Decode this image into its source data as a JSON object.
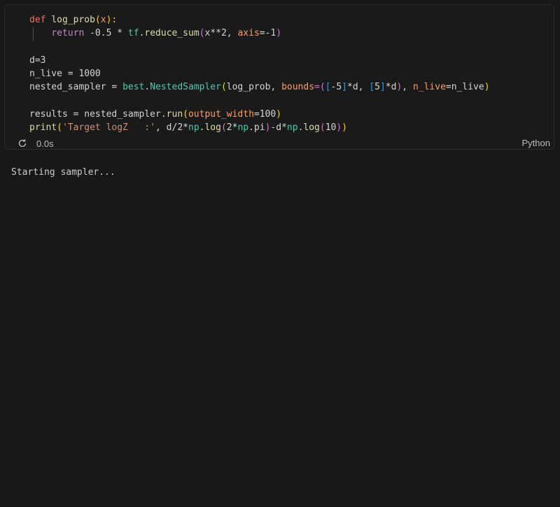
{
  "cell": {
    "language_label": "Python",
    "exec_time": "0.0s",
    "icon": "rerun-icon",
    "code_lines": [
      [
        [
          "def",
          "#f47067"
        ],
        [
          " ",
          "#d4d4d4"
        ],
        [
          "log_prob",
          "#dcdcaa"
        ],
        [
          "(",
          "#ffd700"
        ],
        [
          "x",
          "#ff9e64"
        ],
        [
          "):",
          "#ffd700"
        ]
      ],
      [
        [
          "    ",
          "#d4d4d4"
        ],
        [
          "return",
          "#c586c0"
        ],
        [
          " -0.5 * ",
          "#d4d4d4"
        ],
        [
          "tf",
          "#4ec9b0"
        ],
        [
          ".",
          "#d4d4d4"
        ],
        [
          "reduce_sum",
          "#dcdcaa"
        ],
        [
          "(",
          "#da70d6"
        ],
        [
          "x**2, ",
          "#d4d4d4"
        ],
        [
          "axis",
          "#ff9e64"
        ],
        [
          "=-1",
          "#d4d4d4"
        ],
        [
          ")",
          "#da70d6"
        ]
      ],
      [
        [
          "",
          "#d4d4d4"
        ]
      ],
      [
        [
          "d=3",
          "#d4d4d4"
        ]
      ],
      [
        [
          "n_live = 1000",
          "#d4d4d4"
        ]
      ],
      [
        [
          "nested_sampler = ",
          "#d4d4d4"
        ],
        [
          "best",
          "#4ec9b0"
        ],
        [
          ".",
          "#d4d4d4"
        ],
        [
          "NestedSampler",
          "#4ec9b0"
        ],
        [
          "(",
          "#ffd700"
        ],
        [
          "log_prob, ",
          "#d4d4d4"
        ],
        [
          "bounds",
          "#ff9e64"
        ],
        [
          "=(",
          "#da70d6"
        ],
        [
          "[",
          "#179fff"
        ],
        [
          "-5",
          "#d4d4d4"
        ],
        [
          "]",
          "#179fff"
        ],
        [
          "*d, ",
          "#d4d4d4"
        ],
        [
          "[",
          "#179fff"
        ],
        [
          "5",
          "#d4d4d4"
        ],
        [
          "]",
          "#179fff"
        ],
        [
          "*d",
          "#d4d4d4"
        ],
        [
          ")",
          "#da70d6"
        ],
        [
          ", ",
          "#d4d4d4"
        ],
        [
          "n_live",
          "#ff9e64"
        ],
        [
          "=n_live",
          "#d4d4d4"
        ],
        [
          ")",
          "#ffd700"
        ]
      ],
      [
        [
          "",
          "#d4d4d4"
        ]
      ],
      [
        [
          "results = nested_sampler.",
          "#d4d4d4"
        ],
        [
          "run",
          "#dcdcaa"
        ],
        [
          "(",
          "#ffd700"
        ],
        [
          "output_width",
          "#ff9e64"
        ],
        [
          "=100",
          "#d4d4d4"
        ],
        [
          ")",
          "#ffd700"
        ]
      ],
      [
        [
          "print",
          "#dcdcaa"
        ],
        [
          "(",
          "#ffd700"
        ],
        [
          "'Target logZ   :'",
          "#ce9178"
        ],
        [
          ", d/2*",
          "#d4d4d4"
        ],
        [
          "np",
          "#4ec9b0"
        ],
        [
          ".",
          "#d4d4d4"
        ],
        [
          "log",
          "#dcdcaa"
        ],
        [
          "(",
          "#da70d6"
        ],
        [
          "2*",
          "#d4d4d4"
        ],
        [
          "np",
          "#4ec9b0"
        ],
        [
          ".pi",
          "#d4d4d4"
        ],
        [
          ")",
          "#da70d6"
        ],
        [
          "-d*",
          "#d4d4d4"
        ],
        [
          "np",
          "#4ec9b0"
        ],
        [
          ".",
          "#d4d4d4"
        ],
        [
          "log",
          "#dcdcaa"
        ],
        [
          "(",
          "#da70d6"
        ],
        [
          "10",
          "#d4d4d4"
        ],
        [
          ")",
          "#da70d6"
        ],
        [
          ")",
          "#ffd700"
        ]
      ]
    ]
  },
  "output": {
    "text": "Starting sampler..."
  }
}
